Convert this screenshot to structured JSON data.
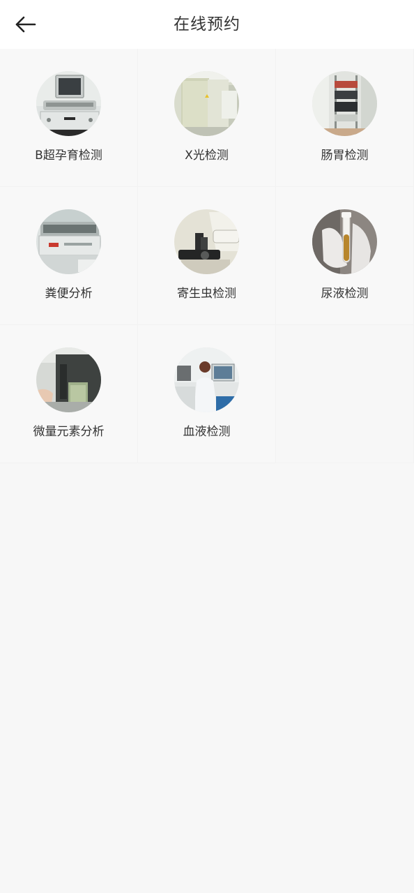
{
  "header": {
    "title": "在线预约"
  },
  "services": [
    {
      "label": "B超孕育检测"
    },
    {
      "label": "X光检测"
    },
    {
      "label": "肠胃检测"
    },
    {
      "label": "粪便分析"
    },
    {
      "label": "寄生虫检测"
    },
    {
      "label": "尿液检测"
    },
    {
      "label": "微量元素分析"
    },
    {
      "label": "血液检测"
    }
  ]
}
